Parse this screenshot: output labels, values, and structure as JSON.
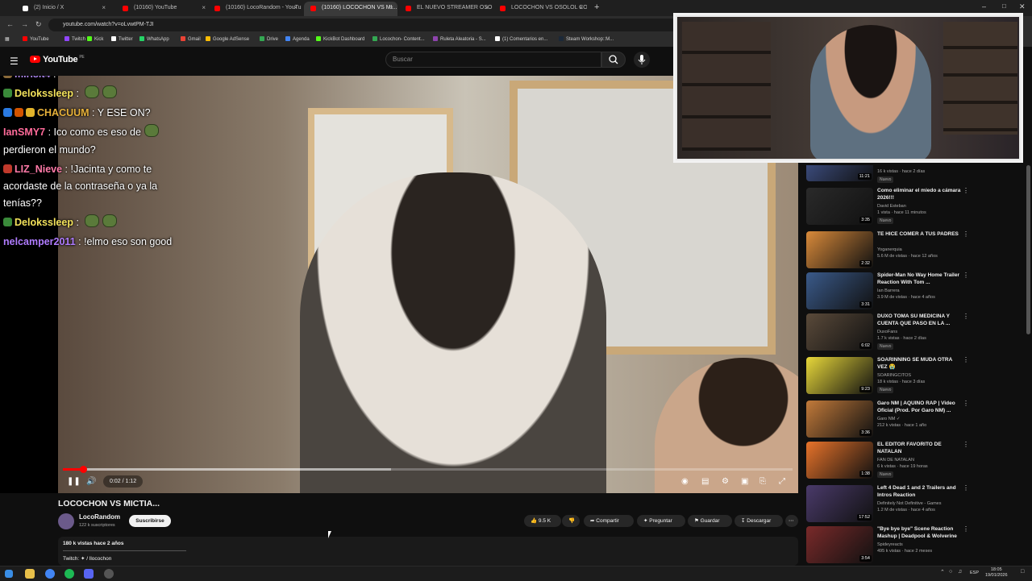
{
  "browser": {
    "tabs": [
      {
        "label": "(2) Inicio / X",
        "color": "#ffffff"
      },
      {
        "label": "(10160) YouTube",
        "color": "#ff0000"
      },
      {
        "label": "(10160) LocoRandom - YouTub...",
        "color": "#ff0000"
      },
      {
        "label": "(10160) LOCOCHON VS MI...",
        "color": "#ff0000"
      },
      {
        "label": "EL NUEVO STREAMER OSOLO...",
        "color": "#ff0000"
      },
      {
        "label": "LOCOCHON VS OSOLOL CON...",
        "color": "#ff0000"
      }
    ],
    "url": "youtube.com/watch?v=oLvwtPM-TJI",
    "bookmarks": [
      {
        "label": "YouTube",
        "color": "#ff0000"
      },
      {
        "label": "Twitch",
        "color": "#9146ff"
      },
      {
        "label": "Kick",
        "color": "#53fc18"
      },
      {
        "label": "Twitter",
        "color": "#ffffff"
      },
      {
        "label": "WhatsApp",
        "color": "#25d366"
      },
      {
        "label": "Gmail",
        "color": "#ea4335"
      },
      {
        "label": "Google AdSense",
        "color": "#fbbc04"
      },
      {
        "label": "Drive",
        "color": "#34a853"
      },
      {
        "label": "Agenda",
        "color": "#4285f4"
      },
      {
        "label": "KickBot Dashboard",
        "color": "#53fc18"
      },
      {
        "label": "Locochon- Content...",
        "color": "#34a853"
      },
      {
        "label": "Ruleta Aleatoria - S...",
        "color": "#8e44ad"
      },
      {
        "label": "(1) Comentarios en...",
        "color": "#ffffff"
      },
      {
        "label": "Steam Workshop::M...",
        "color": "#1b2838"
      }
    ]
  },
  "youtube": {
    "logo": "YouTube",
    "logo_region": "PE",
    "search_placeholder": "Buscar"
  },
  "chat": [
    {
      "user": "mirisit4",
      "color": "#b48cff",
      "text": " : ",
      "badges": [
        "#8a6a3a"
      ]
    },
    {
      "user": "Delokssleep",
      "color": "#f3e25b",
      "text": " : ",
      "badges": [
        "#3a8a3a"
      ],
      "emotes": 2
    },
    {
      "user": "CHACUUM",
      "color": "#e8b23a",
      "text": " : Y ESE ON?",
      "badges": [
        "#2a7ae2",
        "#d35400",
        "#e2b32a"
      ]
    },
    {
      "user": "IanSMY7",
      "color": "#ff6b9a",
      "text": " : Ico como es eso de",
      "badges": [],
      "emotes": 1
    },
    {
      "user": "",
      "color": "#ffffff",
      "text": "perdieron el mundo?",
      "badges": []
    },
    {
      "user": "LIZ_Nieve",
      "color": "#ff7aa8",
      "text": " : !Jacinta y como te",
      "badges": [
        "#c0392b"
      ]
    },
    {
      "user": "",
      "color": "#ffffff",
      "text": "acordaste de la contraseña o ya la",
      "badges": []
    },
    {
      "user": "",
      "color": "#ffffff",
      "text": "tenías??",
      "badges": []
    },
    {
      "user": "Delokssleep",
      "color": "#f3e25b",
      "text": " : ",
      "badges": [
        "#3a8a3a"
      ],
      "emotes": 2
    },
    {
      "user": "nelcamper2011",
      "color": "#b07cff",
      "text": " : !elmo eso son good",
      "badges": []
    }
  ],
  "player": {
    "time": "0:02 / 1:12",
    "progress_fraction": 0.028,
    "buffered_fraction": 0.45
  },
  "video": {
    "title": "LOCOCHON VS MICTIA...",
    "channel": "LocoRandom",
    "subscribers": "122 k suscriptores",
    "subscribe_label": "Suscribirse",
    "likes": "9.5 K",
    "share_label": "Compartir",
    "ask_label": "Preguntar",
    "save_label": "Guardar",
    "download_label": "Descargar",
    "views_date": "180 k vistas  hace 2 años",
    "description": "Twitch: ✦ / llocochon"
  },
  "recommendations": [
    {
      "title": "",
      "channel": "",
      "meta": "16 k vistas · hace 2 días",
      "duration": "11:21",
      "badge": "Nuevo",
      "thumb": "#3a4a7a",
      "partial": true
    },
    {
      "title": "Como eliminar el miedo a cámara 2026!!!",
      "channel": "David Esteban",
      "meta": "1 vista · hace 11 minutos",
      "duration": "3:35",
      "badge": "Nuevo",
      "thumb": "#2a2a2a"
    },
    {
      "title": "TE HICE COMER A TUS PADRES",
      "channel": "Yoganerquia",
      "meta": "5.6 M de vistas · hace 12 años",
      "duration": "2:32",
      "badge": "",
      "thumb": "#d98a3a"
    },
    {
      "title": "Spider-Man No Way Home Trailer Reaction With Tom ...",
      "channel": "Ian Barrera",
      "meta": "3.9 M de vistas · hace 4 años",
      "duration": "3:31",
      "badge": "",
      "thumb": "#3a5a8a"
    },
    {
      "title": "DUXO TOMA SU MEDICINA Y CUENTA QUE PASO EN LA ...",
      "channel": "DuxoFans",
      "meta": "1.7 k vistas · hace 2 días",
      "duration": "6:02",
      "badge": "Nuevo",
      "thumb": "#5a4a3a"
    },
    {
      "title": "SOARINNING SE MUDA OTRA VEZ 😭",
      "channel": "SOARINGCITOS",
      "meta": "18 k vistas · hace 3 días",
      "duration": "9:23",
      "badge": "Nuevo",
      "thumb": "#e8d83a"
    },
    {
      "title": "Garo NM | AQUINO RAP | Video Oficial (Prod. Por Garo NM) ...",
      "channel": "Garo NM ✓",
      "meta": "212 k vistas · hace 1 año",
      "duration": "3:36",
      "badge": "",
      "thumb": "#c27a3a"
    },
    {
      "title": "EL EDITOR FAVORITO DE NATALAN",
      "channel": "FAN DE NATALAN",
      "meta": "6 k vistas · hace 19 horas",
      "duration": "1:38",
      "badge": "Nuevo",
      "thumb": "#e8732a"
    },
    {
      "title": "Left 4 Dead 1 and 2 Trailers and Intros Reaction",
      "channel": "Definitely Not Definitive - Games",
      "meta": "1.2 M de vistas · hace 4 años",
      "duration": "17:52",
      "badge": "",
      "thumb": "#4a3a6a"
    },
    {
      "title": "\"Bye bye bye\" Scene Reaction Mashup | Deadpool & Wolverine",
      "channel": "Spideyreacts",
      "meta": "495 k vistas · hace 2 meses",
      "duration": "3:54",
      "badge": "",
      "thumb": "#7a2a2a"
    }
  ],
  "taskbar": {
    "language": "ESP",
    "time": "18:05",
    "date": "19/01/2026"
  }
}
